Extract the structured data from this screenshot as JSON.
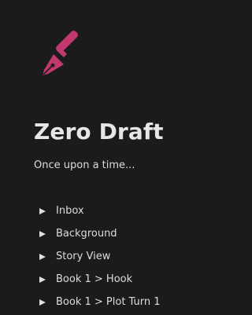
{
  "app": {
    "title": "Zero Draft",
    "tagline": "Once upon a time...",
    "logo_icon": "fountain-pen-icon",
    "accent_color": "#c2396f"
  },
  "nav": {
    "items": [
      {
        "label": "Inbox",
        "icon": "triangle-right-icon"
      },
      {
        "label": "Background",
        "icon": "triangle-right-icon"
      },
      {
        "label": "Story View",
        "icon": "triangle-right-icon"
      },
      {
        "label": "Book 1 > Hook",
        "icon": "triangle-right-icon"
      },
      {
        "label": "Book 1 > Plot Turn 1",
        "icon": "triangle-right-icon"
      }
    ]
  }
}
